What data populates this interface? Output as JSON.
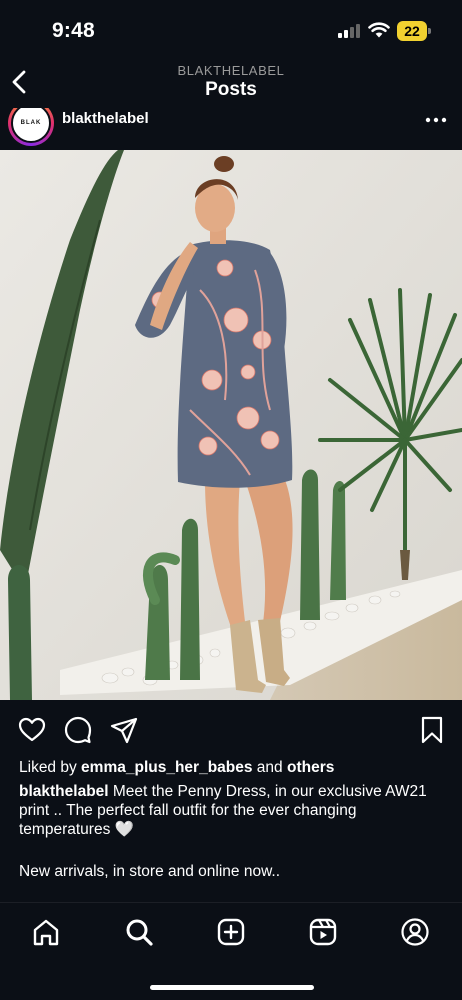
{
  "status_bar": {
    "time": "9:48",
    "battery_level": "22",
    "battery_color": "#f1d130",
    "signal_bars_active": 2
  },
  "nav": {
    "back_icon": "chevron-left-icon",
    "subtitle": "BLAKTHELABEL",
    "title": "Posts"
  },
  "post": {
    "avatar_text": "BLAK",
    "username": "blakthelabel",
    "more_icon": "more-dots-icon"
  },
  "photo": {
    "subject": "model-in-floral-dress-photo"
  },
  "actions": {
    "like_icon": "heart-icon",
    "comment_icon": "comment-icon",
    "share_icon": "send-icon",
    "save_icon": "bookmark-icon"
  },
  "likes": {
    "prefix": "Liked by ",
    "user": "emma_plus_her_babes",
    "middle": " and ",
    "others": "others"
  },
  "caption": {
    "username": "blakthelabel",
    "text": " Meet the Penny Dress, in our exclusive AW21 print .. The perfect fall outfit for the ever changing temperatures 🤍",
    "second_line": "New arrivals, in store and online now.."
  },
  "tabbar": {
    "home": "home-icon",
    "search": "search-icon",
    "create": "add-square-icon",
    "reels": "reels-icon",
    "profile": "profile-icon"
  },
  "colors": {
    "background": "#0b0f16",
    "text": "#ffffff",
    "subtitle": "#9a9a9a"
  }
}
